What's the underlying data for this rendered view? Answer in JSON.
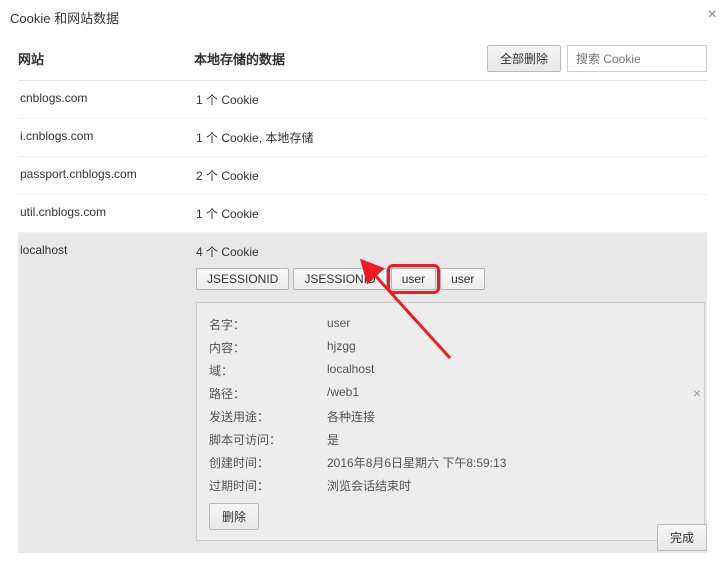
{
  "dialog": {
    "title": "Cookie 和网站数据"
  },
  "header": {
    "site_col": "网站",
    "data_col": "本地存储的数据",
    "delete_all": "全部删除",
    "search_placeholder": "搜索 Cookie"
  },
  "rows": [
    {
      "site": "cnblogs.com",
      "data": "1 个 Cookie"
    },
    {
      "site": "i.cnblogs.com",
      "data": "1 个 Cookie, 本地存储"
    },
    {
      "site": "passport.cnblogs.com",
      "data": "2 个 Cookie"
    },
    {
      "site": "util.cnblogs.com",
      "data": "1 个 Cookie"
    }
  ],
  "selected": {
    "site": "localhost",
    "data": "4 个 Cookie",
    "chips": [
      "JSESSIONID",
      "JSESSIONID",
      "user",
      "user"
    ],
    "highlight_index": 2,
    "details": [
      {
        "label": "名字：",
        "value": "user"
      },
      {
        "label": "内容：",
        "value": "hjzgg"
      },
      {
        "label": "域：",
        "value": "localhost"
      },
      {
        "label": "路径：",
        "value": "/web1"
      },
      {
        "label": "发送用途：",
        "value": "各种连接"
      },
      {
        "label": "脚本可访问：",
        "value": "是"
      },
      {
        "label": "创建时间：",
        "value": "2016年8月6日星期六 下午8:59:13"
      },
      {
        "label": "过期时间：",
        "value": "浏览会话结束时"
      }
    ],
    "delete_btn": "删除"
  },
  "footer": {
    "done": "完成"
  }
}
